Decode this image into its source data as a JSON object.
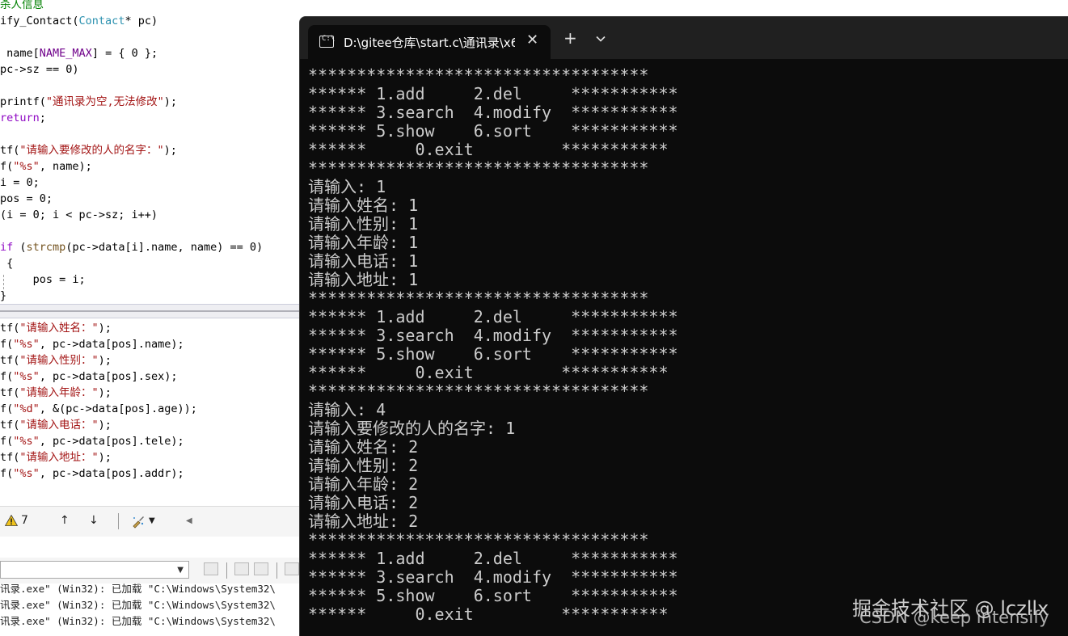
{
  "editor": {
    "code_top": [
      "杀人信息",
      "ify_Contact(Contact* pc)",
      "",
      " name[NAME_MAX] = { 0 };",
      "pc->sz == 0)",
      "",
      "printf(\"通讯录为空,无法修改\");",
      "return;",
      "",
      "tf(\"请输入要修改的人的名字：\");",
      "f(\"%s\", name);",
      "i = 0;",
      "pos = 0;",
      "(i = 0; i < pc->sz; i++)",
      "",
      "if (strcmp(pc->data[i].name, name) == 0)",
      " {",
      "     pos = i;",
      "}"
    ],
    "code_bottom": [
      "tf(\"请输入姓名：\");",
      "f(\"%s\", pc->data[pos].name);",
      "tf(\"请输入性别：\");",
      "f(\"%s\", pc->data[pos].sex);",
      "tf(\"请输入年龄：\");",
      "f(\"%d\", &(pc->data[pos].age));",
      "tf(\"请输入电话：\");",
      "f(\"%s\", pc->data[pos].tele);",
      "tf(\"请输入地址：\");",
      "f(\"%s\", pc->data[pos].addr);"
    ],
    "status": {
      "warning_count": "7",
      "up_arrow": "↑",
      "down_arrow": "↓"
    },
    "output_lines": [
      "讯录.exe\" (Win32): 已加载 \"C:\\Windows\\System32\\",
      "讯录.exe\" (Win32): 已加载 \"C:\\Windows\\System32\\",
      "讯录.exe\" (Win32): 已加载 \"C:\\Windows\\System32\\"
    ]
  },
  "terminal": {
    "tab_title": "D:\\gitee仓库\\start.c\\通讯录\\x6",
    "tab_icon_label": "C:\\",
    "new_tab_label": "+",
    "dropdown_label": "⌄",
    "close_label": "✕",
    "lines": [
      "***********************************",
      "****** 1.add     2.del     ***********",
      "****** 3.search  4.modify  ***********",
      "****** 5.show    6.sort    ***********",
      "******     0.exit         ***********",
      "***********************************",
      "请输入: 1",
      "请输入姓名: 1",
      "请输入性别: 1",
      "请输入年龄: 1",
      "请输入电话: 1",
      "请输入地址: 1",
      "***********************************",
      "****** 1.add     2.del     ***********",
      "****** 3.search  4.modify  ***********",
      "****** 5.show    6.sort    ***********",
      "******     0.exit         ***********",
      "***********************************",
      "请输入: 4",
      "请输入要修改的人的名字: 1",
      "请输入姓名: 2",
      "请输入性别: 2",
      "请输入年龄: 2",
      "请输入电话: 2",
      "请输入地址: 2",
      "***********************************",
      "****** 1.add     2.del     ***********",
      "****** 3.search  4.modify  ***********",
      "****** 5.show    6.sort    ***********",
      "******     0.exit         ***********"
    ]
  },
  "watermark": {
    "line1": "掘金技术社区 @ lczllx",
    "line2": "CSDN @keep intensify"
  }
}
